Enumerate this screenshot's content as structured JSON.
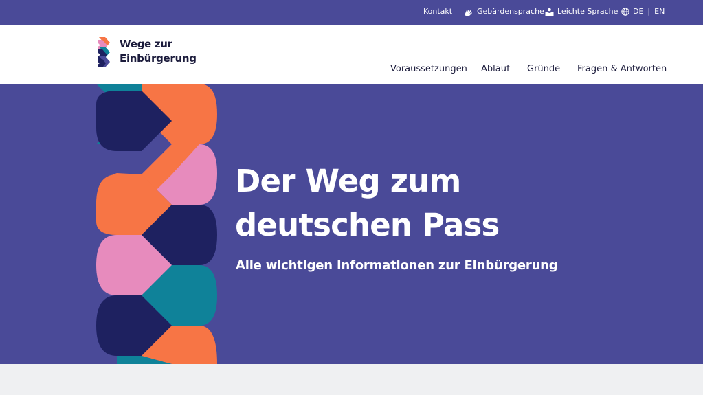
{
  "utility": {
    "contact_label": "Kontakt",
    "sign_language_label": "Gebärdensprache",
    "easy_language_label": "Leichte Sprache",
    "lang_de": "DE",
    "lang_separator": "|",
    "lang_en": "EN"
  },
  "header": {
    "logo_line1": "Wege zur",
    "logo_line2": "Einbürgerung"
  },
  "nav": {
    "items": [
      {
        "label": "Voraussetzungen"
      },
      {
        "label": "Ablauf"
      },
      {
        "label": "Gründe"
      },
      {
        "label": "Fragen & Antworten"
      }
    ]
  },
  "hero": {
    "title_line1": "Der Weg zum",
    "title_line2": "deutschen Pass",
    "subtitle": "Alle wichtigen Informationen zur Einbürgerung"
  },
  "colors": {
    "brand_purple": "#4a4a98",
    "braid_navy": "#1e2160",
    "braid_orange": "#f77545",
    "braid_pink": "#e78bbd",
    "braid_teal": "#0f8299"
  },
  "icons": {
    "sign_language": "hands-icon",
    "easy_language": "book-reader-icon",
    "language": "globe-icon"
  }
}
